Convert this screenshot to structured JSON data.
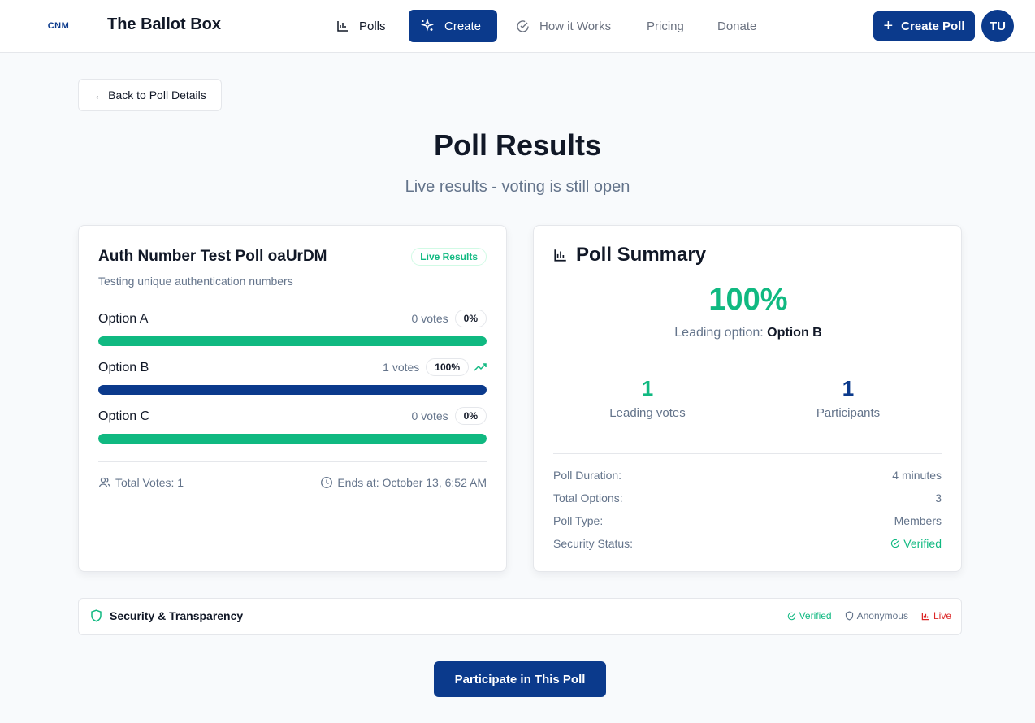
{
  "header": {
    "logo_text": "CNM",
    "brand": "The Ballot Box",
    "nav": {
      "polls": "Polls",
      "create": "Create",
      "how": "How it Works",
      "pricing": "Pricing",
      "donate": "Donate"
    },
    "create_poll_label": "Create Poll",
    "avatar_initials": "TU"
  },
  "back_label": "← Back to Poll Details",
  "page": {
    "title": "Poll Results",
    "subtitle": "Live results - voting is still open"
  },
  "poll": {
    "title": "Auth Number Test Poll oaUrDM",
    "badge": "Live Results",
    "description": "Testing unique authentication numbers",
    "options": [
      {
        "name": "Option A",
        "votes": "0 votes",
        "pct": "0%",
        "fill_fraction": 1.0,
        "color": "#10b981"
      },
      {
        "name": "Option B",
        "votes": "1 votes",
        "pct": "100%",
        "fill_fraction": 1.0,
        "color": "#0b3a8c"
      },
      {
        "name": "Option C",
        "votes": "0 votes",
        "pct": "0%",
        "fill_fraction": 1.0,
        "color": "#10b981"
      }
    ],
    "total_votes": "Total Votes: 1",
    "ends_at": "Ends at: October 13, 6:52 AM"
  },
  "summary": {
    "title": "Poll Summary",
    "big_pct": "100%",
    "leading_label": "Leading option:",
    "leading_value": "Option B",
    "stats": [
      {
        "num": "1",
        "label": "Leading votes"
      },
      {
        "num": "1",
        "label": "Participants"
      }
    ],
    "details": [
      {
        "label": "Poll Duration:",
        "value": "4 minutes"
      },
      {
        "label": "Total Options:",
        "value": "3"
      },
      {
        "label": "Poll Type:",
        "value": "Members"
      },
      {
        "label": "Security Status:",
        "value": "Verified"
      }
    ]
  },
  "security": {
    "title": "Security & Transparency",
    "tags": {
      "verified": "Verified",
      "anonymous": "Anonymous",
      "live": "Live"
    }
  },
  "participate_label": "Participate in This Poll",
  "colors": {
    "primary": "#0b3a8c",
    "success": "#10b981",
    "live": "#dc2626",
    "muted": "#64748b"
  },
  "icons": [
    "bar-chart-icon",
    "sparkles-icon",
    "check-circle-icon",
    "plus-icon",
    "trending-up-icon",
    "users-icon",
    "clock-icon",
    "shield-icon"
  ]
}
